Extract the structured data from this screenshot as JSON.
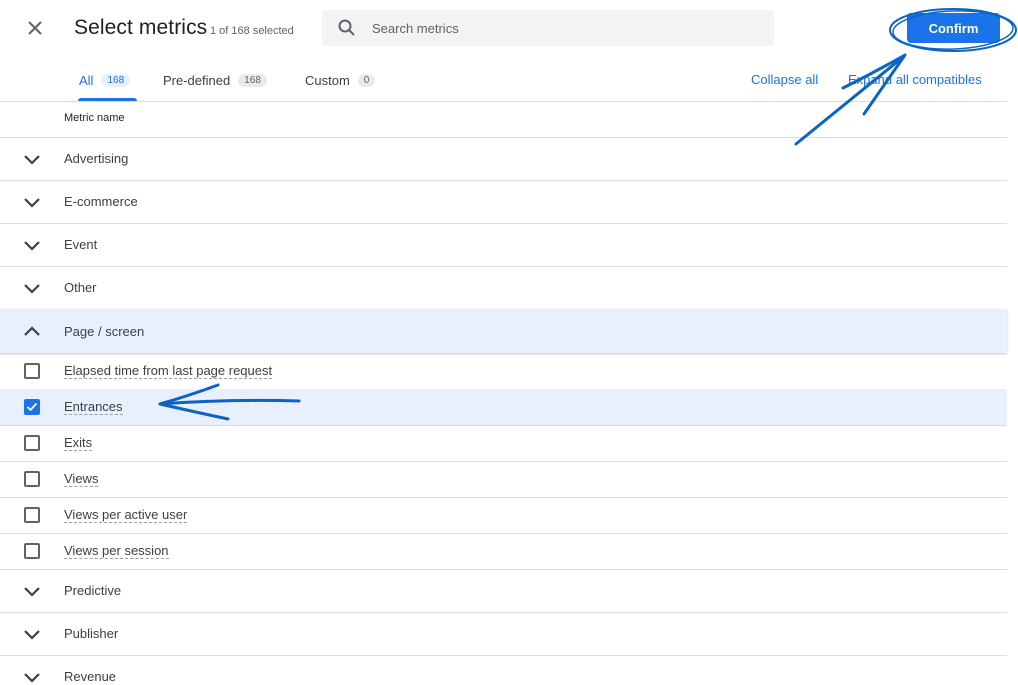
{
  "header": {
    "title": "Select metrics",
    "selected_count": "1 of 168 selected",
    "search_placeholder": "Search metrics",
    "confirm_label": "Confirm"
  },
  "tabs": [
    {
      "label": "All",
      "count": "168",
      "active": true
    },
    {
      "label": "Pre-defined",
      "count": "168",
      "active": false
    },
    {
      "label": "Custom",
      "count": "0",
      "active": false
    }
  ],
  "actions": {
    "collapse_all": "Collapse all",
    "expand_all": "Expand all compatibles"
  },
  "table": {
    "column_header": "Metric name"
  },
  "categories": [
    {
      "label": "Advertising",
      "expanded": false
    },
    {
      "label": "E-commerce",
      "expanded": false
    },
    {
      "label": "Event",
      "expanded": false
    },
    {
      "label": "Other",
      "expanded": false
    },
    {
      "label": "Page / screen",
      "expanded": true
    },
    {
      "label": "Predictive",
      "expanded": false
    },
    {
      "label": "Publisher",
      "expanded": false
    },
    {
      "label": "Revenue",
      "expanded": false
    }
  ],
  "metrics": [
    {
      "label": "Elapsed time from last page request",
      "checked": false
    },
    {
      "label": "Entrances",
      "checked": true
    },
    {
      "label": "Exits",
      "checked": false
    },
    {
      "label": "Views",
      "checked": false
    },
    {
      "label": "Views per active user",
      "checked": false
    },
    {
      "label": "Views per session",
      "checked": false
    }
  ],
  "colors": {
    "accent": "#1a73e8",
    "selected_row": "#e8f0fe",
    "annotation": "#0b63c4"
  }
}
